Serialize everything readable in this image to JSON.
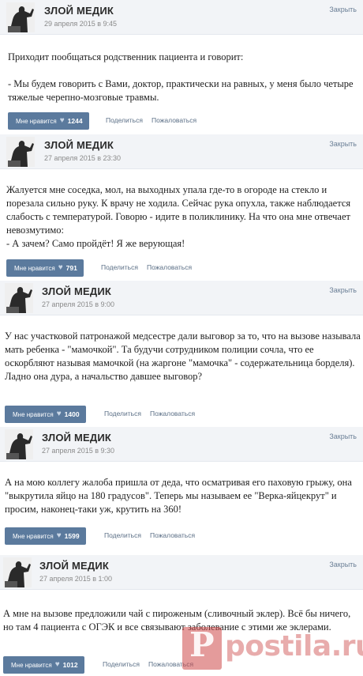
{
  "author_name": "ЗЛОЙ МЕДИК",
  "close_label": "Закрыть",
  "like_label": "Мне нравится",
  "share_label": "Поделиться",
  "report_label": "Пожаловаться",
  "heart_glyph": "♥",
  "posts": [
    {
      "date": "29 апреля 2015 в 9:45",
      "lines": [
        "Приходит пообщаться родственник пациента и говорит:",
        "",
        "- Мы будем говорить с Вами, доктор, практически на равных, у меня было четыре тяжелые черепно-мозговые травмы."
      ],
      "likes": "1244"
    },
    {
      "date": "27 апреля 2015 в 23:30",
      "lines": [
        "Жалуется мне соседка, мол, на выходных упала где-то в огороде на стекло и порезала сильно руку. К врачу не ходила. Сейчас рука опухла, также наблюдается слабость с температурой. Говорю - идите в поликлинику. На что она мне отвечает невозмутимо:",
        "- А зачем? Само пройдёт! Я же верующая!"
      ],
      "likes": "791"
    },
    {
      "date": "27 апреля 2015 в 9:00",
      "lines": [
        "У нас участковой патронажой медсестре дали выговор за то, что на вызове называла мать ребенка - \"мамочкой\". Та будучи сотрудником полиции сочла, что ее оскорбляют называя мамочкой (на жаргоне \"мамочка\" - содержательница борделя).",
        "Ладно она дура, а начальство давшее выговор?"
      ],
      "likes": "1400"
    },
    {
      "date": "27 апреля 2015 в 9:30",
      "lines": [
        "А на мою коллегу жалоба пришла от деда, что осматривая его паховую грыжу, она \"выкрутила яйцо на 180 градусов\". Теперь мы называем ее \"Верка-яйцекрут\" и просим, наконец-таки уж, крутить на 360!"
      ],
      "likes": "1599"
    },
    {
      "date": "27 апреля 2015 в 1:00",
      "lines": [
        "А мне на вызове предложили чай с пироженым (сливочный эклер). Всё бы ничего, но там 4 пациента с ОГЭК и все связывают заболевание с этими же эклерами."
      ],
      "likes": "1012"
    }
  ],
  "watermark": {
    "letter": "P",
    "text": "postila.ru"
  },
  "colors": {
    "like_button": "#5b7a9d",
    "header_bg": "#f2f4f7",
    "link": "#5b6f86",
    "watermark": "#cd4848"
  }
}
